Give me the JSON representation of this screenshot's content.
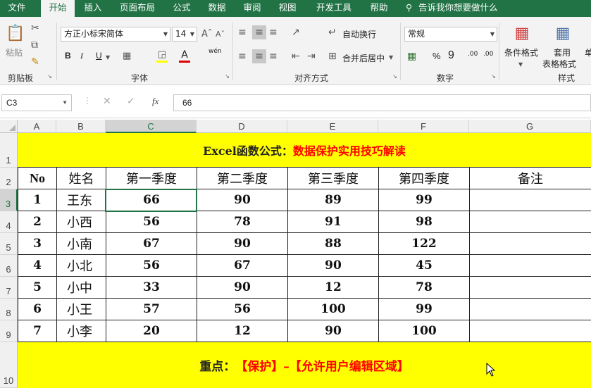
{
  "tabs": [
    "文件",
    "开始",
    "插入",
    "页面布局",
    "公式",
    "数据",
    "审阅",
    "视图",
    "开发工具",
    "帮助"
  ],
  "active_tab": "开始",
  "tell_me": "告诉我你想要做什么",
  "ribbon": {
    "clipboard": {
      "paste": "粘贴",
      "label": "剪贴板"
    },
    "font": {
      "name": "方正小标宋简体",
      "size": "14",
      "bold": "B",
      "italic": "I",
      "underline": "U",
      "wen": "wén",
      "label": "字体"
    },
    "alignment": {
      "wrap": "自动换行",
      "merge": "合并后居中",
      "label": "对齐方式"
    },
    "number": {
      "format": "常规",
      "percent": "%",
      "comma": "9",
      "inc_dec": ".00",
      "label": "数字"
    },
    "styles": {
      "cond": "条件格式",
      "table": "套用",
      "table2": "表格格式",
      "cell_style": "单",
      "label": "样式"
    }
  },
  "formula_bar": {
    "name_box": "C3",
    "fx": "fx",
    "value": "66"
  },
  "sheet": {
    "columns": [
      "A",
      "B",
      "C",
      "D",
      "E",
      "F",
      "G"
    ],
    "rows": [
      "1",
      "2",
      "3",
      "4",
      "5",
      "6",
      "7",
      "8",
      "9",
      "10"
    ],
    "title_black": "Excel函数公式：",
    "title_red": "数据保护实用技巧解读",
    "headers": [
      "No",
      "姓名",
      "第一季度",
      "第二季度",
      "第三季度",
      "第四季度",
      "备注"
    ],
    "data": [
      [
        "1",
        "王东",
        "66",
        "90",
        "89",
        "99",
        ""
      ],
      [
        "2",
        "小西",
        "56",
        "78",
        "91",
        "98",
        ""
      ],
      [
        "3",
        "小南",
        "67",
        "90",
        "88",
        "122",
        ""
      ],
      [
        "4",
        "小北",
        "56",
        "67",
        "90",
        "45",
        ""
      ],
      [
        "5",
        "小中",
        "33",
        "90",
        "12",
        "78",
        ""
      ],
      [
        "6",
        "小王",
        "57",
        "56",
        "100",
        "99",
        ""
      ],
      [
        "7",
        "小李",
        "20",
        "12",
        "90",
        "100",
        ""
      ]
    ],
    "footer_black": "重点：",
    "footer_red": "【保护】–【允许用户编辑区域】"
  },
  "colors": {
    "excel_green": "#217346",
    "banner_yellow": "#ffff00",
    "accent_red": "#ff0000"
  }
}
